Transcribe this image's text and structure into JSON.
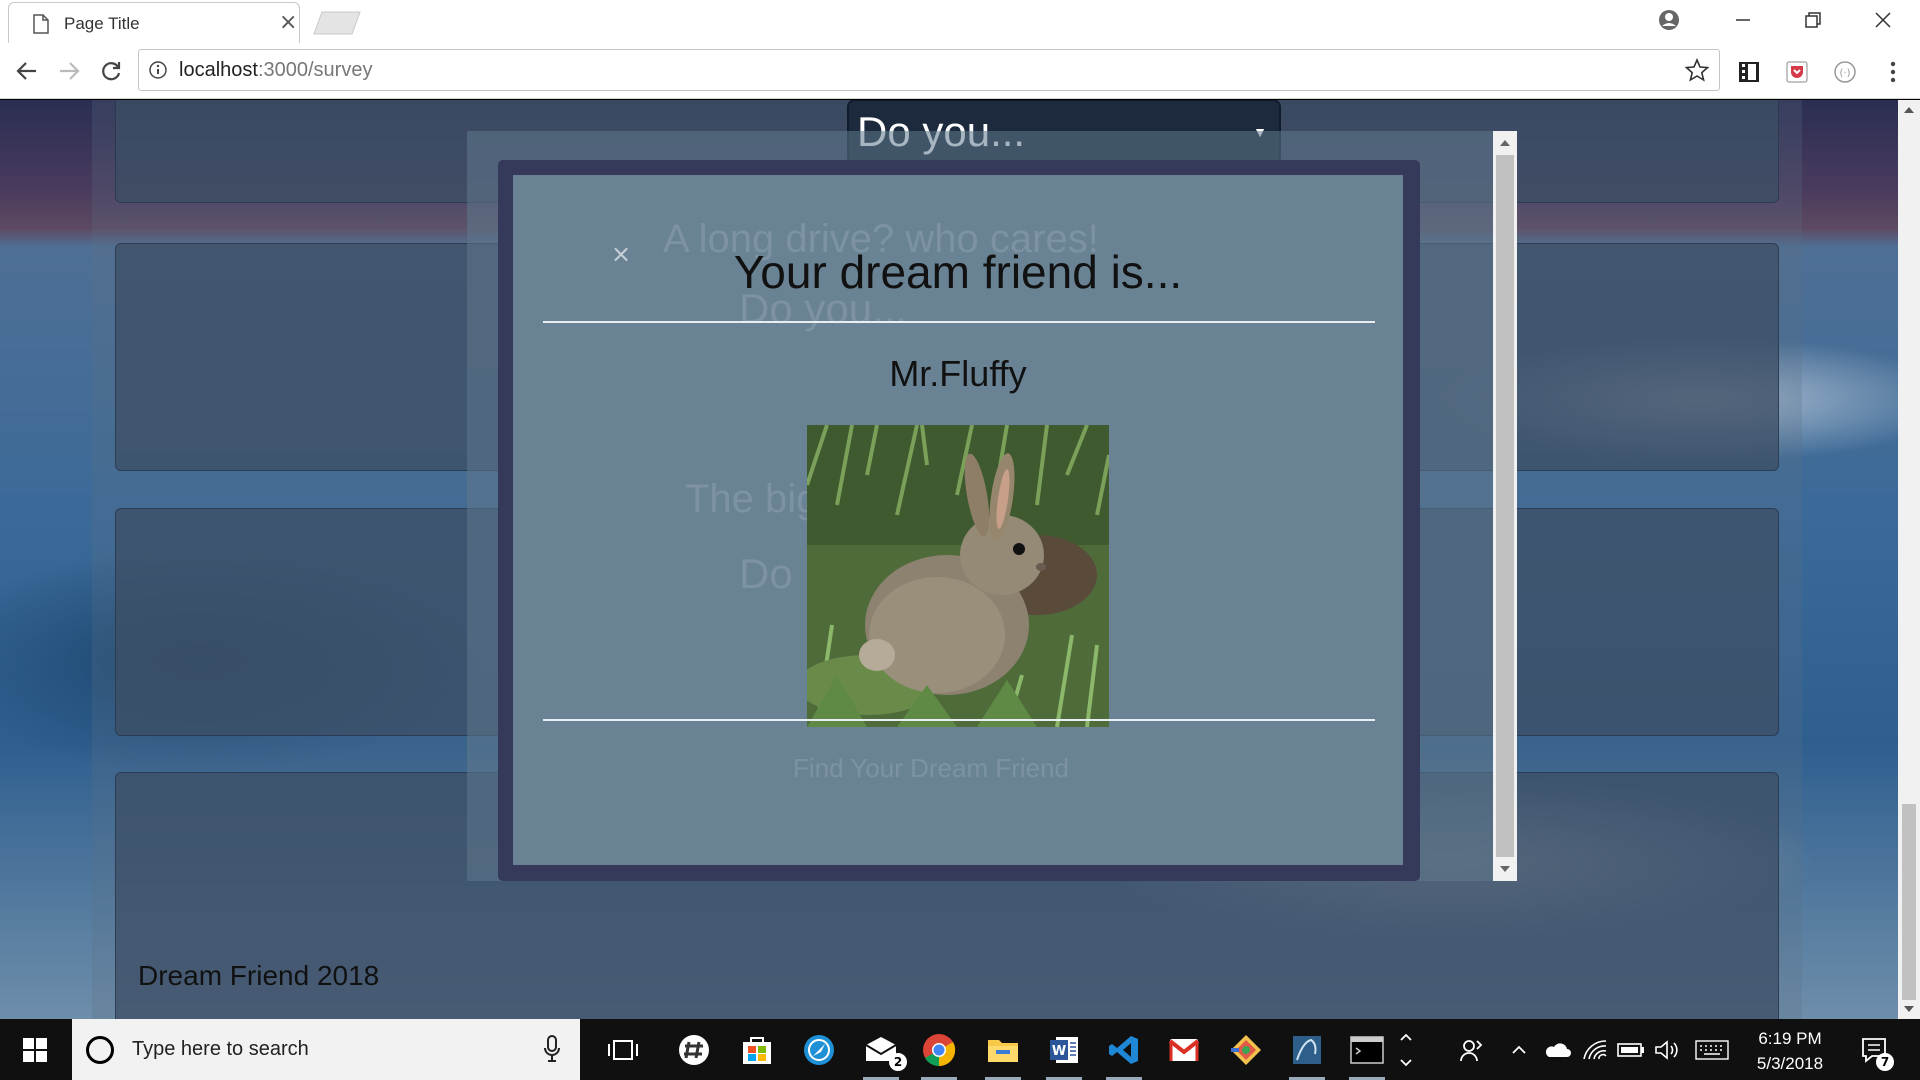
{
  "browser": {
    "tab_title": "Page Title",
    "tab_close": "×",
    "url_host": "localhost",
    "url_path": ":3000/survey"
  },
  "page": {
    "select_placeholder": "Do you...",
    "ghost_question_1": "A long drive? who cares!",
    "ghost_question_2": "The bigger the better",
    "ghost_select_1": "Do you...",
    "ghost_select_2": "Do",
    "ghost_submit": "Find Your Dream Friend",
    "footer": "Dream Friend 2018"
  },
  "modal": {
    "close": "×",
    "title": "Your dream friend is...",
    "friend_name": "Mr.Fluffy",
    "photo_subject": "rabbit"
  },
  "taskbar": {
    "search_placeholder": "Type here to search",
    "mail_badge": "2",
    "time": "6:19 PM",
    "date": "5/3/2018",
    "notification_count": "7"
  },
  "colors": {
    "modal_frame": "#35395a",
    "modal_body": "#6a8394",
    "taskbar": "#101010"
  }
}
